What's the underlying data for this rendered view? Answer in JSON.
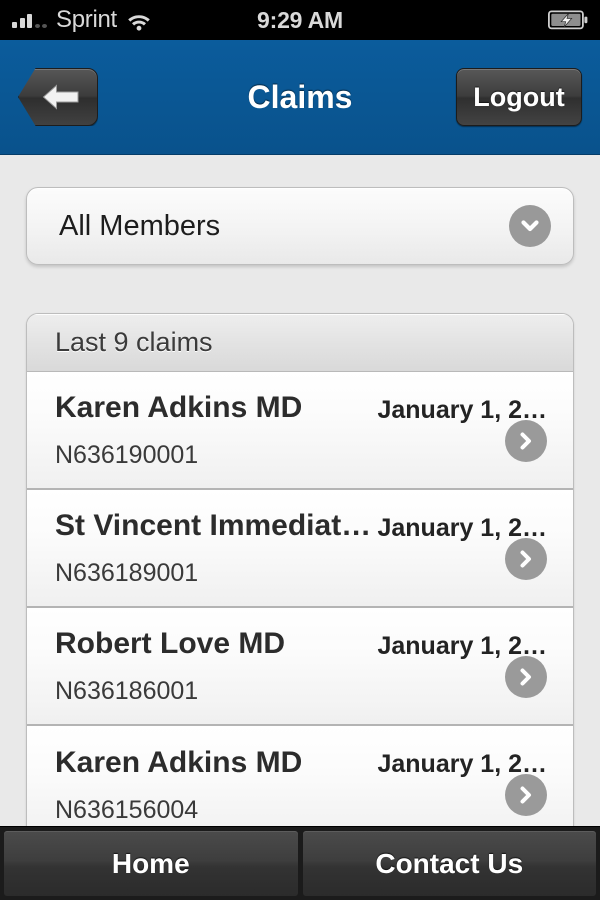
{
  "status_bar": {
    "carrier": "Sprint",
    "time": "9:29 AM",
    "signal_icon": "signal-bars-icon",
    "wifi_icon": "wifi-icon",
    "battery_icon": "battery-charging-icon"
  },
  "nav": {
    "title": "Claims",
    "back_icon": "back-arrow-icon",
    "logout_label": "Logout"
  },
  "filter": {
    "selected": "All Members",
    "chevron_icon": "chevron-down-icon"
  },
  "claims_list": {
    "header": "Last 9 claims",
    "rows": [
      {
        "provider": "Karen Adkins MD",
        "number": "N636190001",
        "date": "January 1, 2…"
      },
      {
        "provider": "St Vincent Immediat…",
        "number": "N636189001",
        "date": "January 1, 2…"
      },
      {
        "provider": "Robert Love MD",
        "number": "N636186001",
        "date": "January 1, 2…"
      },
      {
        "provider": "Karen Adkins MD",
        "number": "N636156004",
        "date": "January 1, 2…"
      }
    ]
  },
  "tab_bar": {
    "home_label": "Home",
    "contact_label": "Contact Us"
  },
  "colors": {
    "nav_blue": "#0a5591",
    "page_background": "#e9e9e9",
    "accent_gray": "#999999",
    "tab_dark": "#3a3a3a"
  }
}
